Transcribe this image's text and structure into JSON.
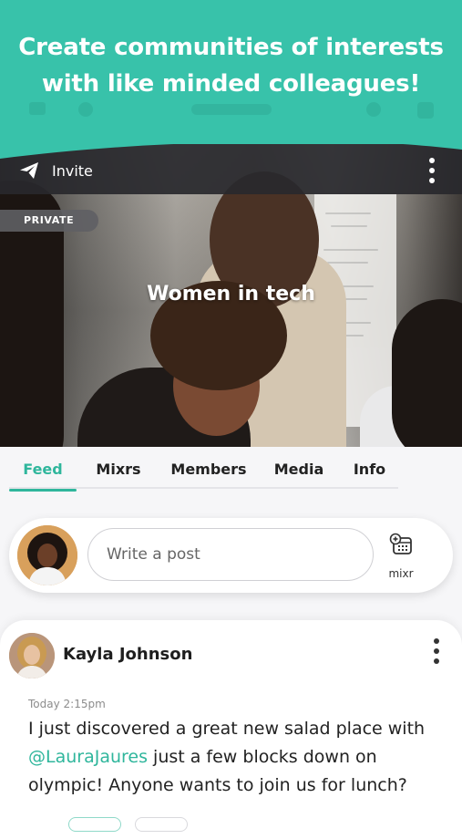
{
  "promo": {
    "headline": "Create communities of interests\nwith like minded colleagues!",
    "color": "#38c2aa"
  },
  "group": {
    "invite_label": "Invite",
    "privacy": "PRIVATE",
    "name": "Women in tech"
  },
  "tabs": {
    "items": [
      {
        "label": "Feed",
        "active": true
      },
      {
        "label": "Mixrs",
        "active": false
      },
      {
        "label": "Members",
        "active": false
      },
      {
        "label": "Media",
        "active": false
      },
      {
        "label": "Info",
        "active": false
      }
    ],
    "accent": "#2fb69c"
  },
  "composer": {
    "placeholder": "Write a post",
    "mixr_label": "mixr"
  },
  "post": {
    "author": "Kayla Johnson",
    "timestamp": "Today 2:15pm",
    "text_before": "I just discovered a great new salad place with ",
    "mention": "@LauraJaures",
    "text_after": " just a few blocks down on olympic! Anyone wants to join us for lunch?"
  },
  "icons": {
    "invite": "paper-plane-icon",
    "menu": "vertical-dots-icon",
    "mixr": "calendar-plus-icon"
  }
}
